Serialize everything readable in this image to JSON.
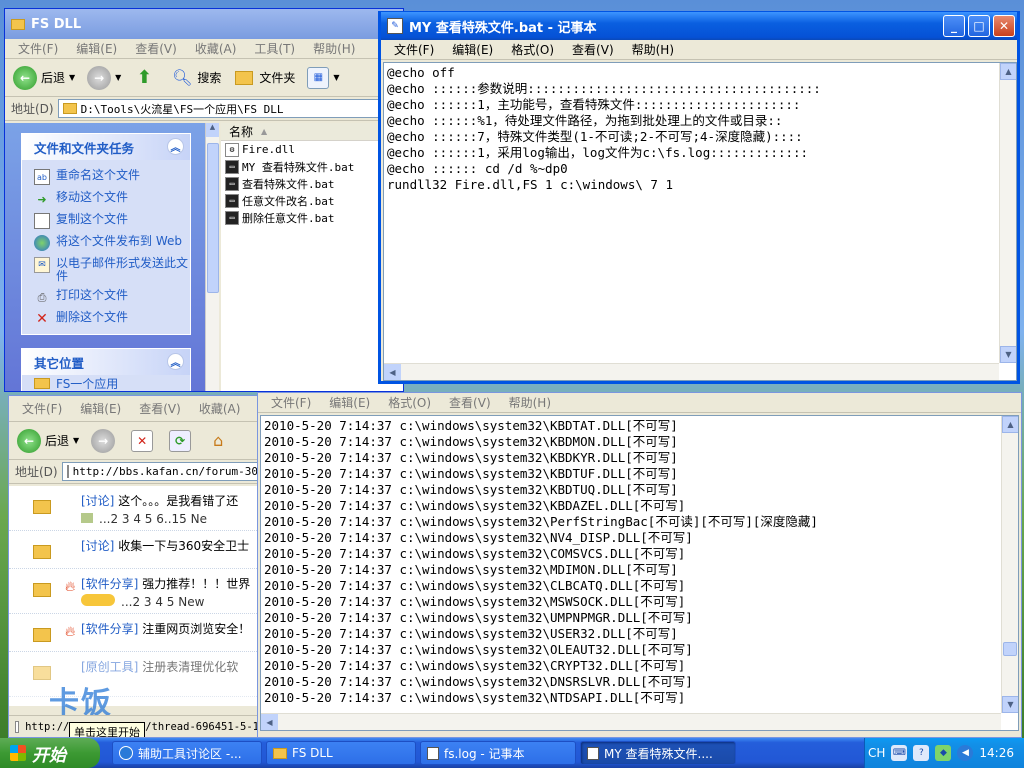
{
  "explorer": {
    "title": "FS DLL",
    "menu": [
      "文件(F)",
      "编辑(E)",
      "查看(V)",
      "收藏(A)",
      "工具(T)",
      "帮助(H)"
    ],
    "toolbar": {
      "back": "后退",
      "search": "搜索",
      "folders": "文件夹"
    },
    "address_label": "地址(D)",
    "address_value": "D:\\Tools\\火流星\\FS一个应用\\FS DLL",
    "file_tasks_title": "文件和文件夹任务",
    "file_tasks": [
      "重命名这个文件",
      "移动这个文件",
      "复制这个文件",
      "将这个文件发布到 Web",
      "以电子邮件形式发送此文件",
      "打印这个文件",
      "删除这个文件"
    ],
    "other_places_title": "其它位置",
    "other_places_first": "FS一个应用",
    "column_name": "名称",
    "files": [
      "Fire.dll",
      "MY 查看特殊文件.bat",
      "查看特殊文件.bat",
      "任意文件改名.bat",
      "删除任意文件.bat"
    ]
  },
  "notepad1": {
    "title": "MY 查看特殊文件.bat - 记事本",
    "menu": [
      "文件(F)",
      "编辑(E)",
      "格式(O)",
      "查看(V)",
      "帮助(H)"
    ],
    "lines": [
      "@echo off",
      "@echo ::::::参数说明:::::::::::::::::::::::::::::::::::::::",
      "@echo ::::::1，主功能号，查看特殊文件::::::::::::::::::::::",
      "@echo ::::::%1，待处理文件路径，为拖到批处理上的文件或目录::",
      "@echo ::::::7，特殊文件类型(1-不可读;2-不可写;4-深度隐藏)::::",
      "@echo ::::::1，采用log输出，log文件为c:\\fs.log:::::::::::::",
      "@echo :::::: cd /d %~dp0",
      "rundll32 Fire.dll,FS 1 c:\\windows\\ 7 1"
    ]
  },
  "browser": {
    "menu": [
      "文件(F)",
      "编辑(E)",
      "查看(V)",
      "收藏(A)"
    ],
    "back": "后退",
    "address_label": "地址(D)",
    "address_value": "http://bbs.kafan.cn/forum-30-",
    "rows": [
      {
        "tag": "[讨论]",
        "text": " 这个。。。是我看错了还",
        "pages": "...2 3 4 5 6..15 Ne"
      },
      {
        "tag": "[讨论]",
        "text": " 收集一下与360安全卫士",
        "pages": ""
      },
      {
        "tag": "[软件分享]",
        "text": " 强力推荐！！！世界",
        "pages": "...2 3 4 5 New"
      },
      {
        "tag": "[软件分享]",
        "text": " 注重网页浏览安全！",
        "pages": ""
      },
      {
        "tag": "[原创工具]",
        "text": " 注册表清理优化软",
        "pages": ""
      }
    ],
    "status": "http://bbs.kafan.cn/thread-696451-5-1",
    "tooltip": "单击这里开始",
    "watermark": "卡饭"
  },
  "notepad2": {
    "menu": [
      "文件(F)",
      "编辑(E)",
      "格式(O)",
      "查看(V)",
      "帮助(H)"
    ],
    "lines": [
      "2010-5-20 7:14:37 c:\\windows\\system32\\KBDTAT.DLL[不可写]",
      "2010-5-20 7:14:37 c:\\windows\\system32\\KBDMON.DLL[不可写]",
      "2010-5-20 7:14:37 c:\\windows\\system32\\KBDKYR.DLL[不可写]",
      "2010-5-20 7:14:37 c:\\windows\\system32\\KBDTUF.DLL[不可写]",
      "2010-5-20 7:14:37 c:\\windows\\system32\\KBDTUQ.DLL[不可写]",
      "2010-5-20 7:14:37 c:\\windows\\system32\\KBDAZEL.DLL[不可写]",
      "2010-5-20 7:14:37 c:\\windows\\system32\\PerfStringBac[不可读][不可写][深度隐藏]",
      "2010-5-20 7:14:37 c:\\windows\\system32\\NV4_DISP.DLL[不可写]",
      "2010-5-20 7:14:37 c:\\windows\\system32\\COMSVCS.DLL[不可写]",
      "2010-5-20 7:14:37 c:\\windows\\system32\\MDIMON.DLL[不可写]",
      "2010-5-20 7:14:37 c:\\windows\\system32\\CLBCATQ.DLL[不可写]",
      "2010-5-20 7:14:37 c:\\windows\\system32\\MSWSOCK.DLL[不可写]",
      "2010-5-20 7:14:37 c:\\windows\\system32\\UMPNPMGR.DLL[不可写]",
      "2010-5-20 7:14:37 c:\\windows\\system32\\USER32.DLL[不可写]",
      "2010-5-20 7:14:37 c:\\windows\\system32\\OLEAUT32.DLL[不可写]",
      "2010-5-20 7:14:37 c:\\windows\\system32\\CRYPT32.DLL[不可写]",
      "2010-5-20 7:14:37 c:\\windows\\system32\\DNSRSLVR.DLL[不可写]",
      "2010-5-20 7:14:37 c:\\windows\\system32\\NTDSAPI.DLL[不可写]"
    ]
  },
  "taskbar": {
    "start": "开始",
    "items": [
      "辅助工具讨论区 -...",
      "FS DLL",
      "fs.log - 记事本",
      "MY 查看特殊文件...."
    ],
    "lang": "CH",
    "clock": "14:26"
  }
}
